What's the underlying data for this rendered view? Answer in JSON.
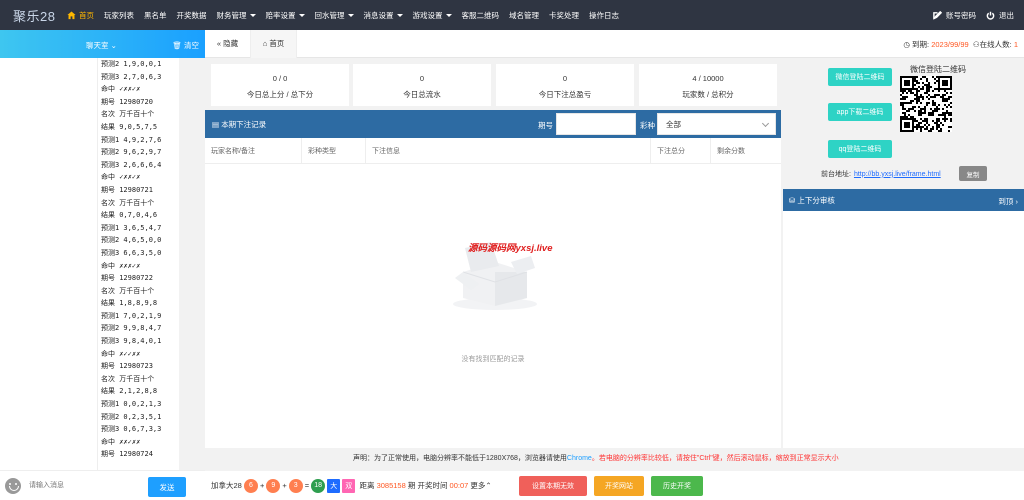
{
  "app": {
    "logo": "聚乐28"
  },
  "nav": [
    {
      "label": "首页",
      "active": true,
      "caret": false
    },
    {
      "label": "玩家列表",
      "caret": false
    },
    {
      "label": "黑名单",
      "caret": false
    },
    {
      "label": "开奖数据",
      "caret": false
    },
    {
      "label": "财务管理",
      "caret": true
    },
    {
      "label": "赔率设置",
      "caret": true
    },
    {
      "label": "回水管理",
      "caret": true
    },
    {
      "label": "消息设置",
      "caret": true
    },
    {
      "label": "游戏设置",
      "caret": true
    },
    {
      "label": "客服二维码",
      "caret": false
    },
    {
      "label": "域名管理",
      "caret": false
    },
    {
      "label": "卡奖处理",
      "caret": false
    },
    {
      "label": "操作日志",
      "caret": false
    }
  ],
  "top_right": {
    "account": "账号密码",
    "logout": "退出"
  },
  "chat": {
    "room": "聊天室",
    "clear": "清空",
    "lines": [
      "预测2 1,9,0,0,1",
      "预测3 2,7,0,6,3",
      "命中  ✓✗✗✓✗",
      "期号  12980720",
      "名次  万千百十个",
      "结果  9,0,5,7,5",
      "预测1 4,9,2,7,6",
      "预测2 9,6,2,9,7",
      "预测3 2,6,6,6,4",
      "命中  ✓✗✗✓✗",
      "期号  12980721",
      "名次  万千百十个",
      "结果  0,7,0,4,6",
      "预测1 3,6,5,4,7",
      "预测2 4,6,5,0,0",
      "预测3 6,6,3,5,0",
      "命中  ✗✗✗✓✗",
      "期号  12980722",
      "名次  万千百十个",
      "结果  1,8,8,9,8",
      "预测1 7,0,2,1,9",
      "预测2 9,9,8,4,7",
      "预测3 9,8,4,0,1",
      "命中  ✗✓✓✗✗",
      "期号  12980723",
      "名次  万千百十个",
      "结果  2,1,2,8,8",
      "预测1 0,0,2,1,3",
      "预测2 0,2,3,5,1",
      "预测3 0,6,7,3,3",
      "命中  ✗✗✓✗✗",
      "期号  12980724"
    ],
    "input_placeholder": "请输入消息",
    "send": "发送"
  },
  "tabs": {
    "hide": "隐藏",
    "home": "首页",
    "expire_label": "到期:",
    "expire_value": "2023/99/99",
    "online_label": "在线人数:",
    "online_value": "1"
  },
  "stats": [
    {
      "value": "0 / 0",
      "label": "今日总上分 / 总下分"
    },
    {
      "value": "0",
      "label": "今日总流水"
    },
    {
      "value": "0",
      "label": "今日下注总盈亏"
    },
    {
      "value": "4 / 10000",
      "label": "玩家数 / 总积分"
    }
  ],
  "bet": {
    "title": "本期下注记录",
    "period_label": "期号",
    "period_value": "",
    "type_label": "彩种",
    "type_value": "全部",
    "columns": [
      "玩家名称/备注",
      "彩种类型",
      "下注信息",
      "下注总分",
      "剩余分数"
    ],
    "empty": "没有找到匹配的记录",
    "watermark": "源码源码网yxsj.live"
  },
  "qr": {
    "title": "微信登陆二维码",
    "buttons": [
      "微信登陆二维码",
      "app下载二维码",
      "qq登陆二维码"
    ],
    "front_label": "前台地址:",
    "front_url": "http://bb.yxsj.live/frame.html",
    "copy": "复制"
  },
  "audit": {
    "title": "上下分审核",
    "top": "到顶"
  },
  "notice": {
    "prefix": "声明：为了正常使用，电脑分辨率不能低于1280X768，浏览器请使用",
    "browser": "Chrome",
    "suffix": "。若电脑的分辨率比较低，请按住\"Ctrl\"键，然后滚动鼠标，缩放到正常显示大小"
  },
  "draw": {
    "game": "加拿大28",
    "n1": "6",
    "n2": "9",
    "n3": "3",
    "sum": "18",
    "size": "大",
    "parity": "双",
    "distance_label": "距离",
    "period": "3085158",
    "period_suffix": "期 开奖时间",
    "countdown": "00:07",
    "more": "更多",
    "btn_cancel": "设置本期无效",
    "btn_site": "开奖网站",
    "btn_history": "历史开奖"
  },
  "colors": {
    "topbar": "#2f3542",
    "active_nav": "#ffb800",
    "panel_head": "#2d6ba3",
    "qr_button": "#2ed3c5",
    "ball_orange": "#ff7f50",
    "ball_green": "#2e9e4f",
    "size_blue": "#1e6cff",
    "parity_pink": "#ff66b3",
    "btn_red": "#f0605a",
    "btn_orange": "#f5a623",
    "btn_green": "#4cb84c"
  }
}
